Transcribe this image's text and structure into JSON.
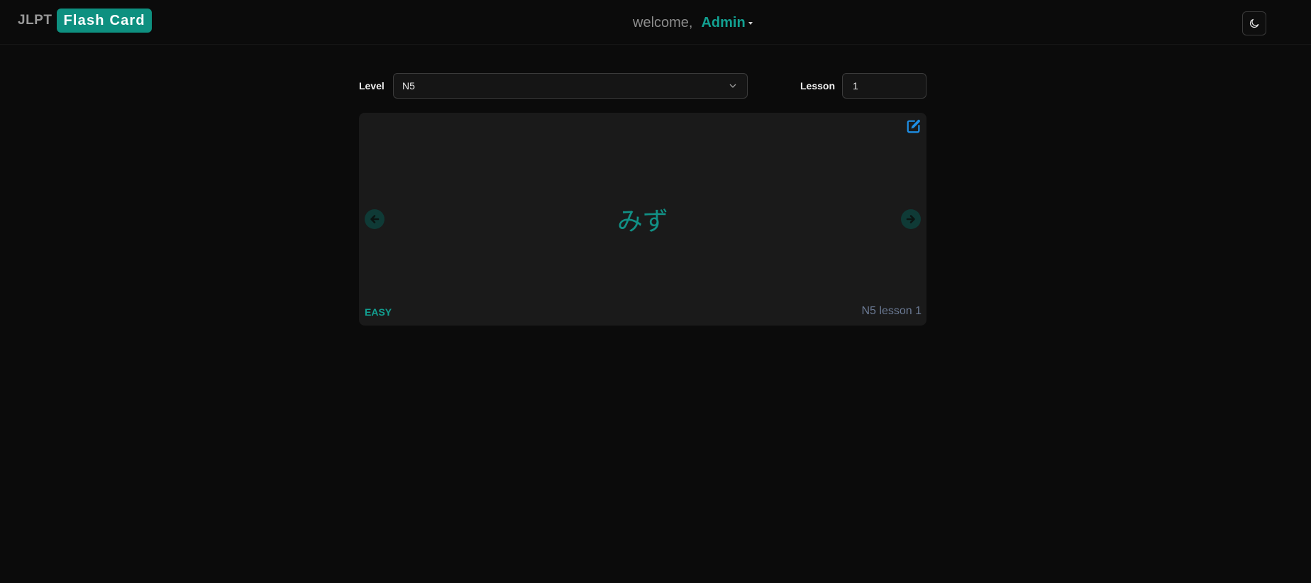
{
  "header": {
    "brand_prefix": "JLPT",
    "brand_badge": "Flash Card",
    "welcome_text": "welcome,",
    "username": "Admin",
    "theme_toggle_icon": "moon-icon"
  },
  "controls": {
    "level_label": "Level",
    "level_value": "N5",
    "lesson_label": "Lesson",
    "lesson_value": "1"
  },
  "card": {
    "word": "みず",
    "difficulty": "EASY",
    "tag": "N5 lesson 1",
    "edit_icon": "edit-icon",
    "prev_icon": "arrow-left-icon",
    "next_icon": "arrow-right-icon"
  },
  "colors": {
    "accent": "#0e9080",
    "background": "#0b0b0b",
    "card_background": "#1a1a1a",
    "edit_icon": "#1e8fe6",
    "tag_text": "#6b7a94"
  }
}
